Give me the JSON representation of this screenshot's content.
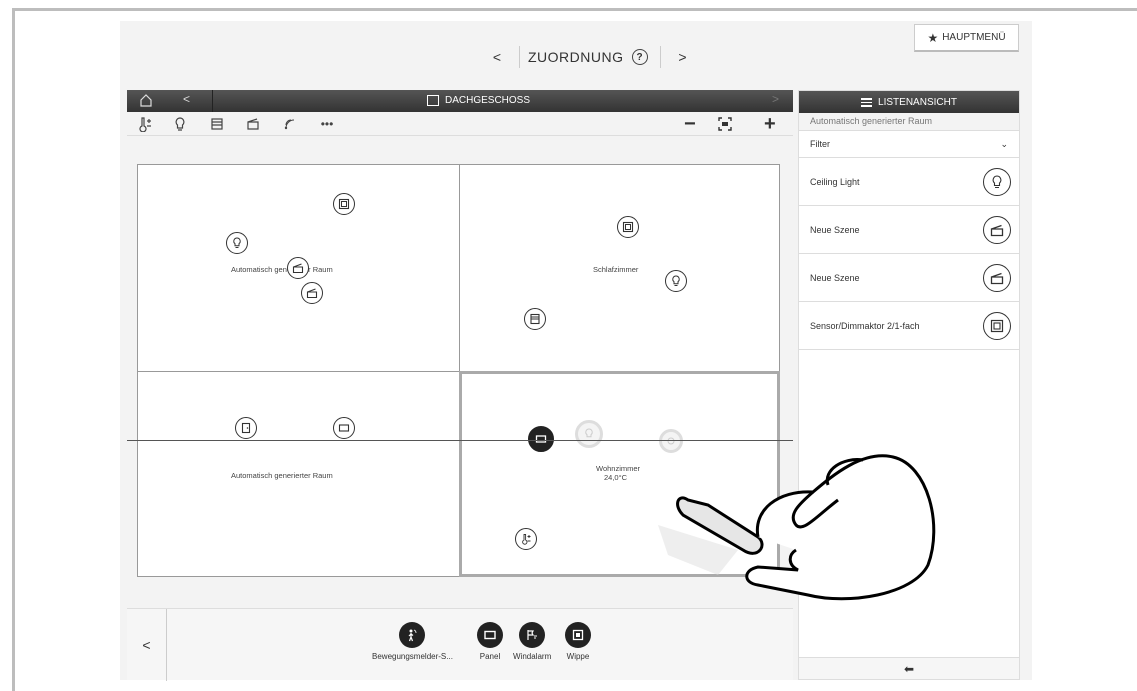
{
  "topbar": {
    "prev": "<",
    "title": "ZUORDNUNG",
    "help": "?",
    "next": ">",
    "mainmenu": "HAUPTMENÜ"
  },
  "plan": {
    "back": "<",
    "title": "DACHGESCHOSS",
    "forward": ">",
    "toolbar_more": "•••",
    "zoom_out": "−",
    "zoom_in": "+",
    "rooms": {
      "r1": "Automatisch generierter Raum",
      "r2": "Schlafzimmer",
      "r3": "Automatisch generierter Raum",
      "r4_name": "Wohnzimmer",
      "r4_temp": "24,0°C"
    }
  },
  "palette": {
    "back": "<",
    "items": [
      "Bewegungsmelder-S...",
      "Panel",
      "Windalarm",
      "Wippe"
    ]
  },
  "rpanel": {
    "title": "LISTENANSICHT",
    "subtitle": "Automatisch generierter Raum",
    "filter": "Filter",
    "items": [
      "Ceiling Light",
      "Neue Szene",
      "Neue Szene",
      "Sensor/Dimmaktor 2/1-fach"
    ]
  },
  "icons": [
    "home-icon",
    "lightbulb-icon",
    "scene-icon",
    "switch-icon",
    "panel-icon",
    "thermostat-icon",
    "motion-sensor-icon",
    "wind-alarm-icon",
    "door-icon",
    "list-icon",
    "star-icon",
    "reply-icon"
  ]
}
